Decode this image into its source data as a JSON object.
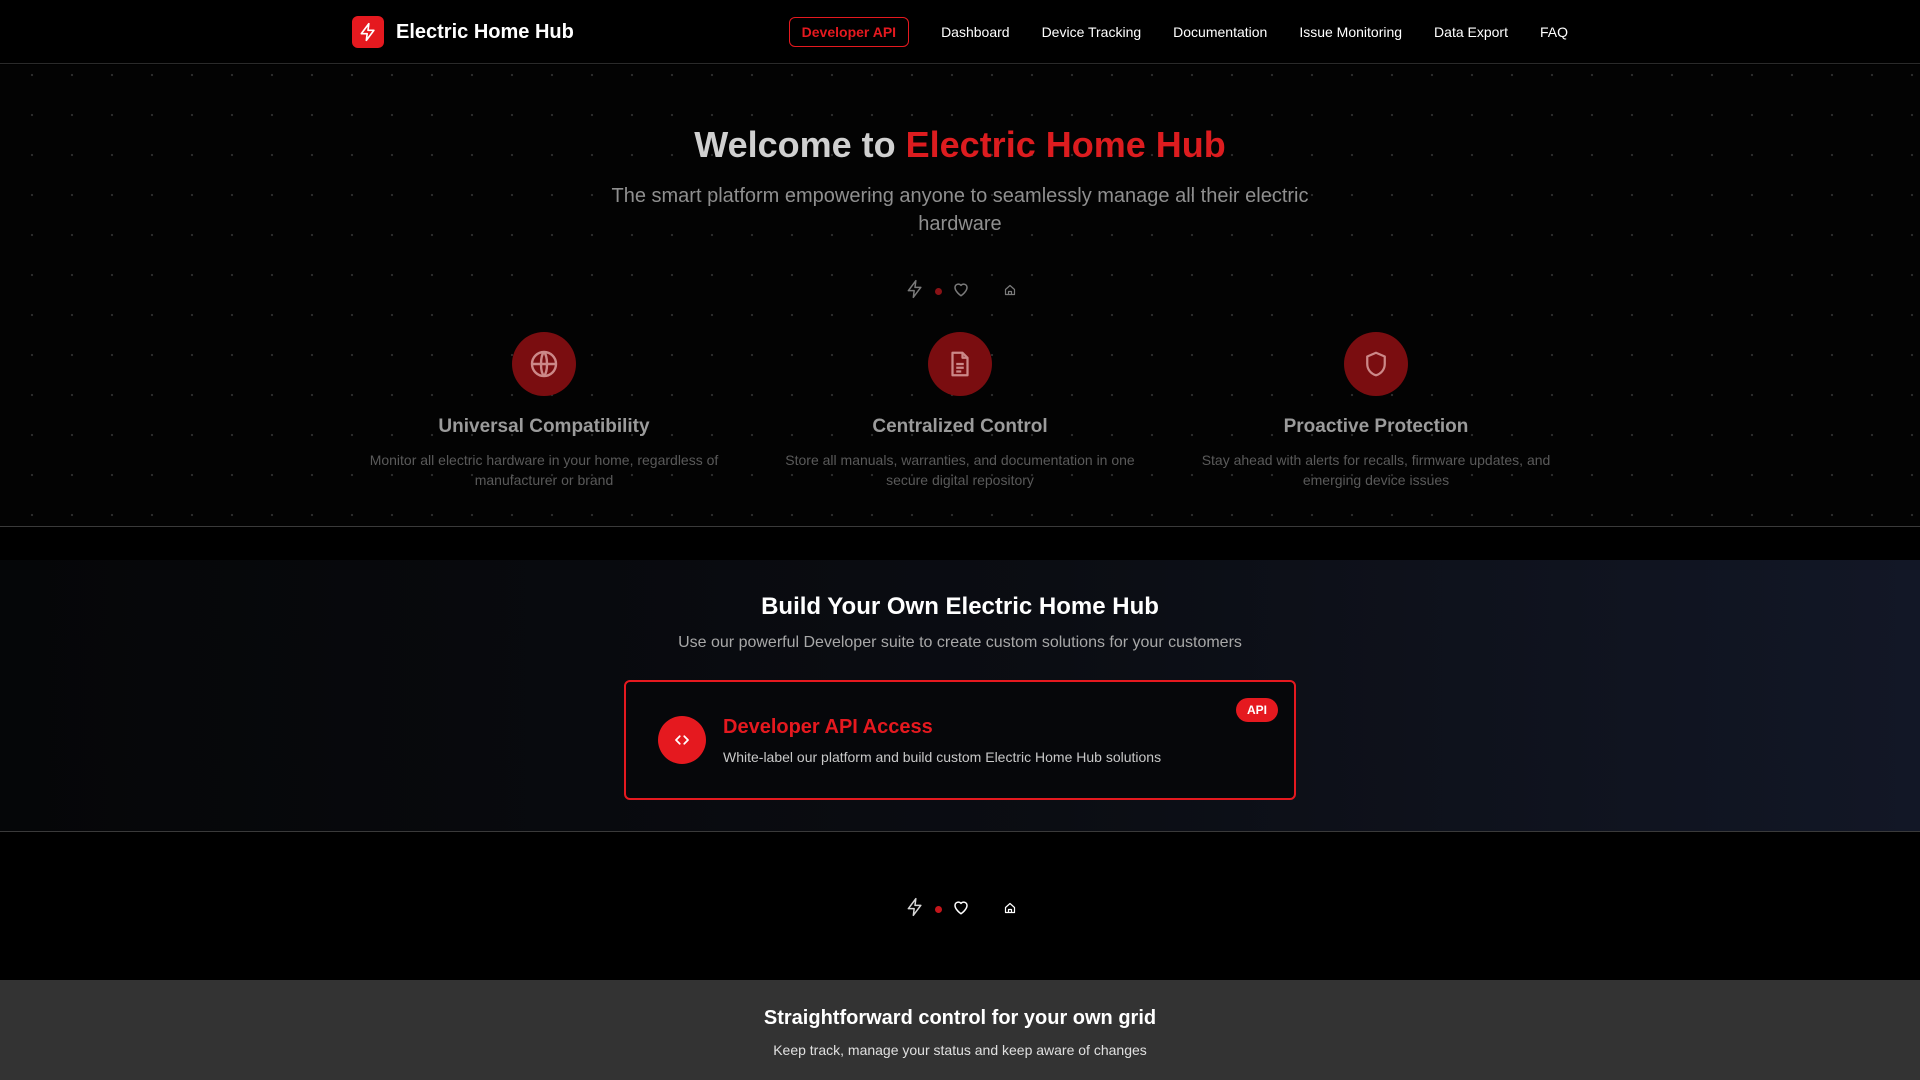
{
  "nav": {
    "brand_name": "Electric Home Hub",
    "brand_icon": "bolt-icon",
    "api_button": "Developer API",
    "links": [
      "Dashboard",
      "Device Tracking",
      "Documentation",
      "Issue Monitoring",
      "Data Export",
      "FAQ"
    ]
  },
  "hero": {
    "title_prefix": "Welcome to ",
    "title_accent": "Electric Home Hub",
    "subtitle": "The smart platform empowering anyone to seamlessly manage all their electric hardware",
    "icons": [
      "bolt-icon",
      "dot",
      "heart-icon",
      "home-icon"
    ],
    "features": [
      {
        "icon": "globe-icon",
        "title": "Universal Compatibility",
        "desc": "Monitor all electric hardware in your home, regardless of manufacturer or brand"
      },
      {
        "icon": "document-icon",
        "title": "Centralized Control",
        "desc": "Store all manuals, warranties, and documentation in one secure digital repository"
      },
      {
        "icon": "shield-icon",
        "title": "Proactive Protection",
        "desc": "Stay ahead with alerts for recalls, firmware updates, and emerging device issues"
      }
    ]
  },
  "developer": {
    "title": "Build Your Own Electric Home Hub",
    "subtitle": "Use our powerful Developer suite to create custom solutions for your customers",
    "card": {
      "icon": "code-icon",
      "title": "Developer API Access",
      "desc": "White-label our platform and build custom Electric Home Hub solutions",
      "badge": "API"
    }
  },
  "footer": {
    "title": "Straightforward control for your own grid",
    "subtitle": "Keep track, manage your status and keep aware of changes"
  },
  "colors": {
    "accent": "#e5191f",
    "background": "#000000",
    "feature_icon_bg": "#7a0d10",
    "footer_bg": "#333333"
  }
}
